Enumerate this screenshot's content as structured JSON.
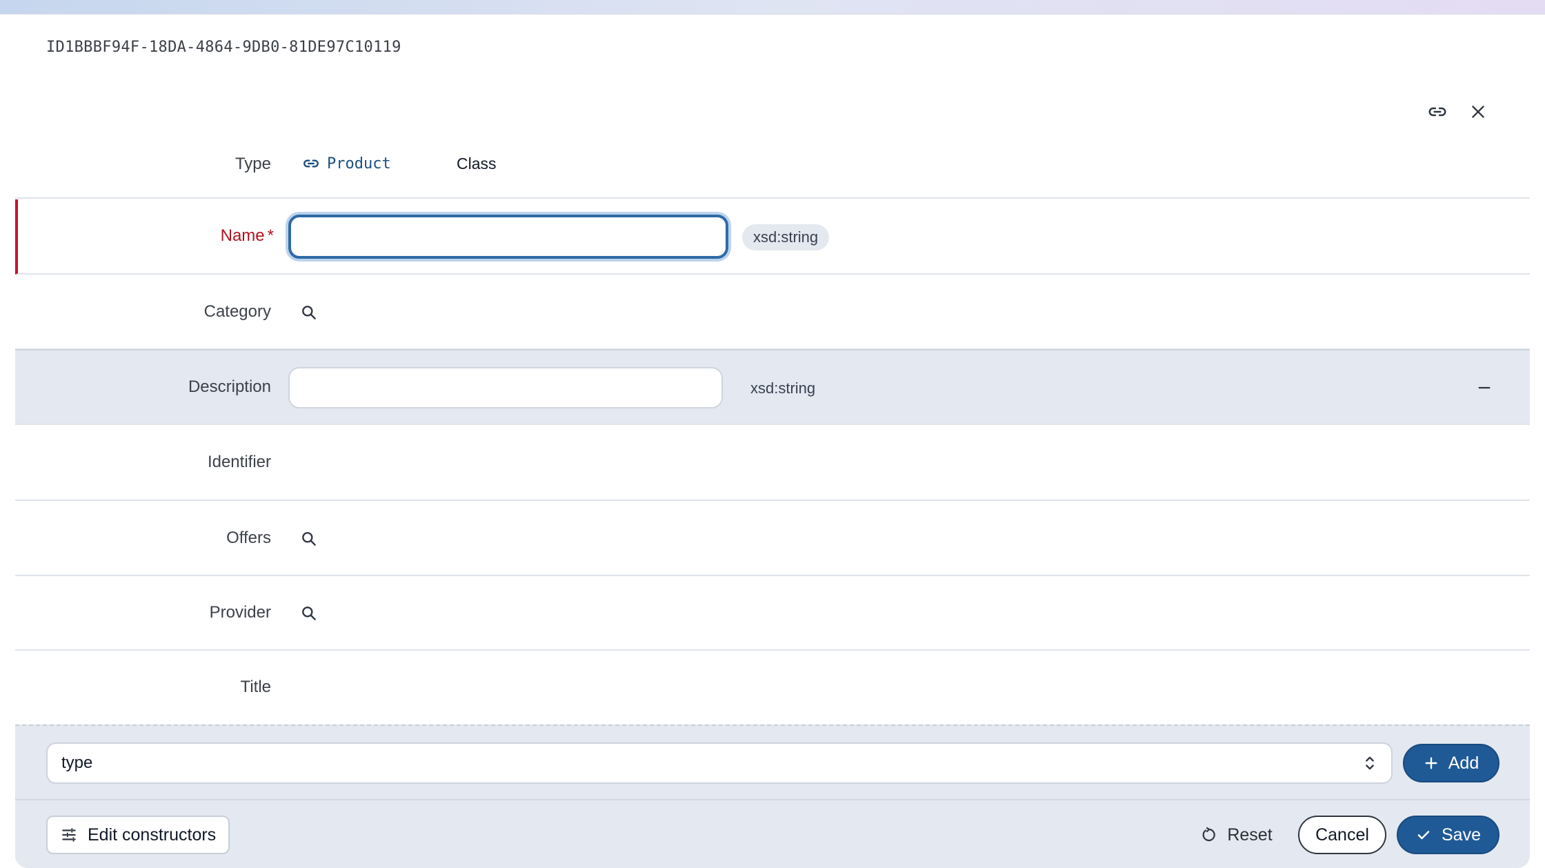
{
  "document": {
    "id": "ID1BBBF94F-18DA-4864-9DB0-81DE97C10119"
  },
  "header_actions": {
    "link_icon": "link-icon",
    "close_icon": "close-icon"
  },
  "type_row": {
    "label": "Type",
    "type_link": "Product",
    "type_kind": "Class"
  },
  "fields": {
    "name": {
      "label": "Name",
      "required_marker": "*",
      "value": "",
      "datatype": "xsd:string"
    },
    "category": {
      "label": "Category"
    },
    "description": {
      "label": "Description",
      "value": "",
      "datatype": "xsd:string",
      "remove_icon": "minus-icon"
    },
    "identifier": {
      "label": "Identifier"
    },
    "offers": {
      "label": "Offers"
    },
    "provider": {
      "label": "Provider"
    },
    "title": {
      "label": "Title"
    }
  },
  "add_property": {
    "selected": "type",
    "add_label": "Add"
  },
  "actions": {
    "edit_constructors_label": "Edit constructors",
    "reset_label": "Reset",
    "cancel_label": "Cancel",
    "save_label": "Save"
  },
  "colors": {
    "primary": "#1f5a96",
    "required": "#b0131f",
    "shaded_row": "#e4e8f0",
    "link": "#1d4f80"
  }
}
